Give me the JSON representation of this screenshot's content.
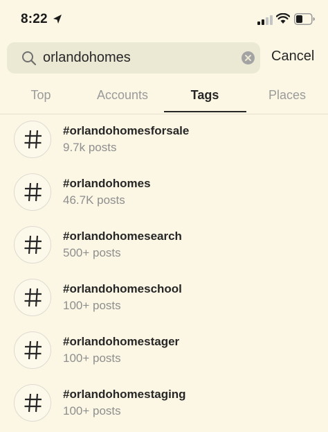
{
  "status_bar": {
    "time": "8:22",
    "icons": [
      "location-arrow-icon",
      "cellular-signal-icon",
      "wifi-icon",
      "battery-icon"
    ]
  },
  "search": {
    "value": "orlandohomes",
    "clear_icon": "clear-icon",
    "search_icon": "search-icon",
    "cancel_label": "Cancel"
  },
  "tabs": [
    {
      "label": "Top",
      "active": false
    },
    {
      "label": "Accounts",
      "active": false
    },
    {
      "label": "Tags",
      "active": true
    },
    {
      "label": "Places",
      "active": false
    }
  ],
  "results": [
    {
      "tag": "#orlandohomesforsale",
      "posts": "9.7k posts"
    },
    {
      "tag": "#orlandohomes",
      "posts": "46.7K posts"
    },
    {
      "tag": "#orlandohomesearch",
      "posts": "500+ posts"
    },
    {
      "tag": "#orlandohomeschool",
      "posts": "100+ posts"
    },
    {
      "tag": "#orlandohomestager",
      "posts": "100+ posts"
    },
    {
      "tag": "#orlandohomestaging",
      "posts": "100+ posts"
    }
  ],
  "colors": {
    "background": "#fbf7e4",
    "search_field": "#ebe8d4",
    "primary_text": "#262626",
    "secondary_text": "#8e8e8e",
    "inactive_tab": "#9a9a9a"
  }
}
